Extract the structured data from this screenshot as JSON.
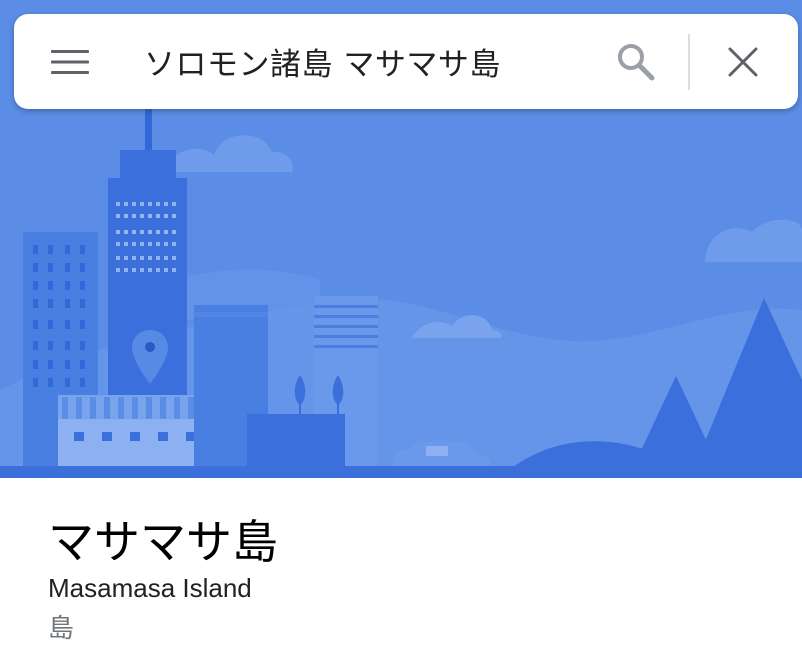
{
  "search": {
    "query": "ソロモン諸島 マサマサ島"
  },
  "icons": {
    "menu": "hamburger-menu-icon",
    "search": "search-icon",
    "clear": "close-icon",
    "hero": "city-skyline-illustration"
  },
  "place": {
    "title": "マサマサ島",
    "subtitle": "Masamasa Island",
    "category": "島"
  },
  "colors": {
    "hero_background": "#5b8de6",
    "hero_primary": "#3a6fdc",
    "ground": "#3b6fd9",
    "icon_gray": "#5f6368",
    "search_icon_gray": "#9aa0a6",
    "category_gray": "#70757a"
  }
}
